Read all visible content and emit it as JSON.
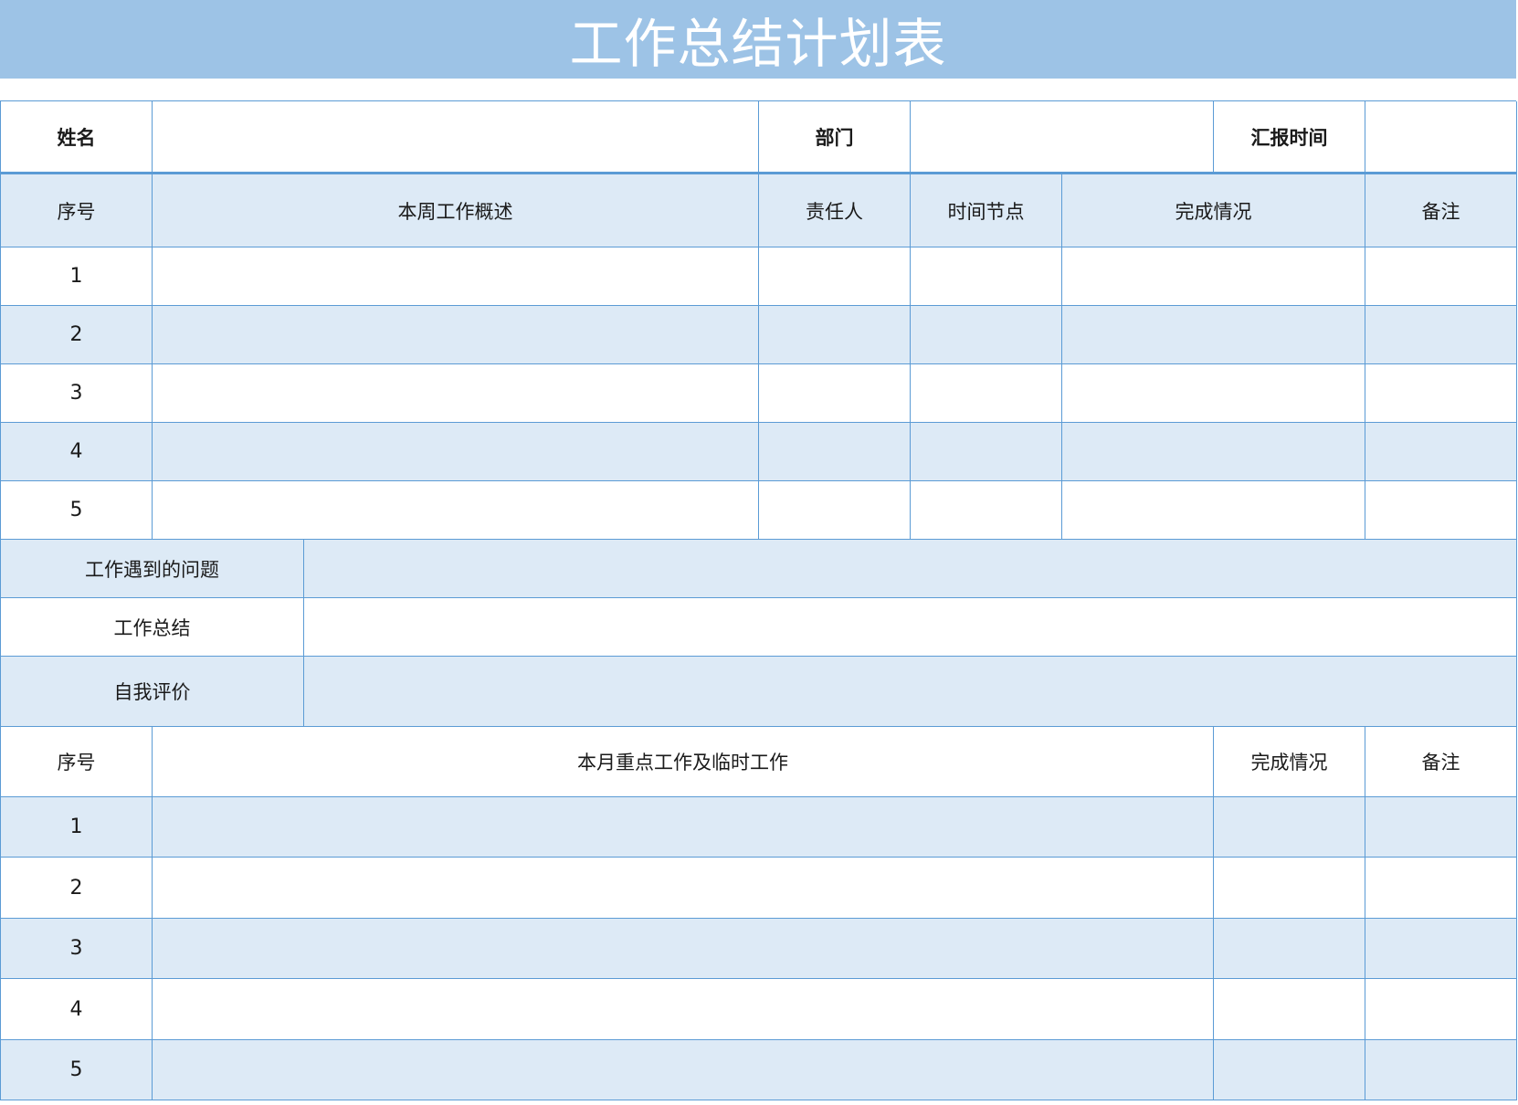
{
  "title": "工作总结计划表",
  "info_row": {
    "name_label": "姓名",
    "name_value": "",
    "dept_label": "部门",
    "dept_value": "",
    "report_time_label": "汇报时间",
    "report_time_value": ""
  },
  "weekly": {
    "headers": {
      "index": "序号",
      "overview": "本周工作概述",
      "owner": "责任人",
      "milestone": "时间节点",
      "status": "完成情况",
      "remarks": "备注"
    },
    "rows": [
      {
        "index": "1",
        "overview": "",
        "owner": "",
        "milestone": "",
        "status": "",
        "remarks": ""
      },
      {
        "index": "2",
        "overview": "",
        "owner": "",
        "milestone": "",
        "status": "",
        "remarks": ""
      },
      {
        "index": "3",
        "overview": "",
        "owner": "",
        "milestone": "",
        "status": "",
        "remarks": ""
      },
      {
        "index": "4",
        "overview": "",
        "owner": "",
        "milestone": "",
        "status": "",
        "remarks": ""
      },
      {
        "index": "5",
        "overview": "",
        "owner": "",
        "milestone": "",
        "status": "",
        "remarks": ""
      }
    ]
  },
  "summary": {
    "problems_label": "工作遇到的问题",
    "problems_value": "",
    "summary_label": "工作总结",
    "summary_value": "",
    "self_eval_label": "自我评价",
    "self_eval_value": ""
  },
  "monthly": {
    "headers": {
      "index": "序号",
      "focus": "本月重点工作及临时工作",
      "status": "完成情况",
      "remarks": "备注"
    },
    "rows": [
      {
        "index": "1",
        "focus": "",
        "status": "",
        "remarks": ""
      },
      {
        "index": "2",
        "focus": "",
        "status": "",
        "remarks": ""
      },
      {
        "index": "3",
        "focus": "",
        "status": "",
        "remarks": ""
      },
      {
        "index": "4",
        "focus": "",
        "status": "",
        "remarks": ""
      },
      {
        "index": "5",
        "focus": "",
        "status": "",
        "remarks": ""
      }
    ]
  },
  "colors": {
    "title_bar": "#9dc3e6",
    "row_tint": "#ddeaf6",
    "border": "#5b9bd5"
  }
}
